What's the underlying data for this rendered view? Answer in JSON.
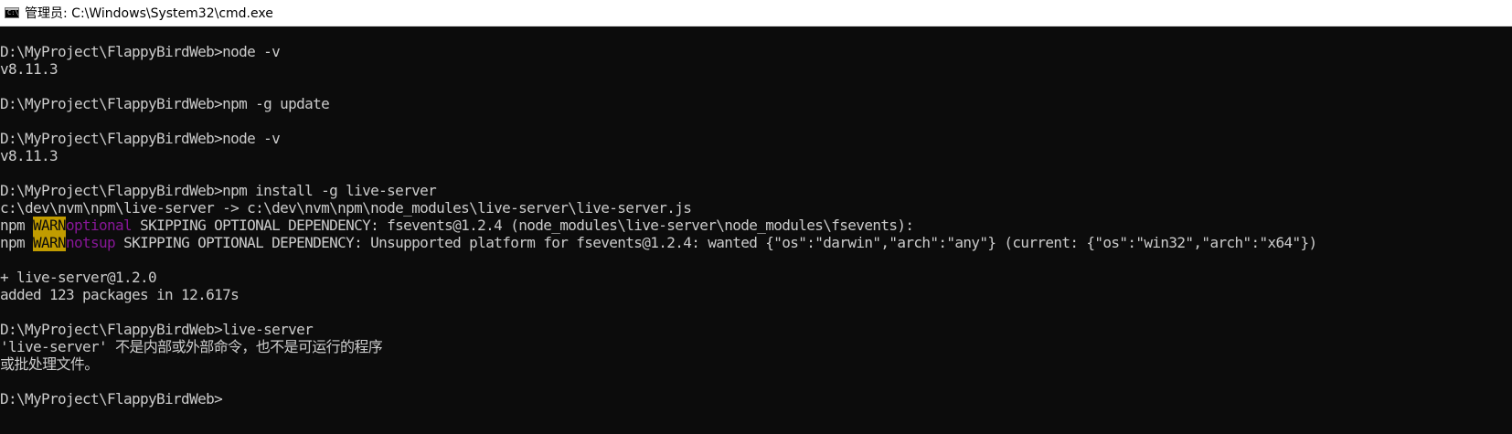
{
  "window": {
    "title": "管理员: C:\\Windows\\System32\\cmd.exe",
    "icon": "cmd-icon",
    "icon_text": "C:\\"
  },
  "colors": {
    "background": "#0c0c0c",
    "foreground": "#cccccc",
    "warn_bg": "#c19c00",
    "warn_fg": "#0c0c0c",
    "magenta": "#881798"
  },
  "console": {
    "lines": [
      "D:\\MyProject\\FlappyBirdWeb>node -v",
      "v8.11.3",
      "",
      "D:\\MyProject\\FlappyBirdWeb>npm -g update",
      "",
      "D:\\MyProject\\FlappyBirdWeb>node -v",
      "v8.11.3",
      "",
      "D:\\MyProject\\FlappyBirdWeb>npm install -g live-server",
      "c:\\dev\\nvm\\npm\\live-server -> c:\\dev\\nvm\\npm\\node_modules\\live-server\\live-server.js",
      {
        "prefix": "npm ",
        "level": "WARN",
        "tag": "optional",
        "message": " SKIPPING OPTIONAL DEPENDENCY: fsevents@1.2.4 (node_modules\\live-server\\node_modules\\fsevents):"
      },
      {
        "prefix": "npm ",
        "level": "WARN",
        "tag": "notsup",
        "message": " SKIPPING OPTIONAL DEPENDENCY: Unsupported platform for fsevents@1.2.4: wanted {\"os\":\"darwin\",\"arch\":\"any\"} (current: {\"os\":\"win32\",\"arch\":\"x64\"})"
      },
      "",
      "+ live-server@1.2.0",
      "added 123 packages in 12.617s",
      "",
      "D:\\MyProject\\FlappyBirdWeb>live-server",
      "'live-server' 不是内部或外部命令，也不是可运行的程序",
      "或批处理文件。",
      "",
      "D:\\MyProject\\FlappyBirdWeb>"
    ]
  }
}
